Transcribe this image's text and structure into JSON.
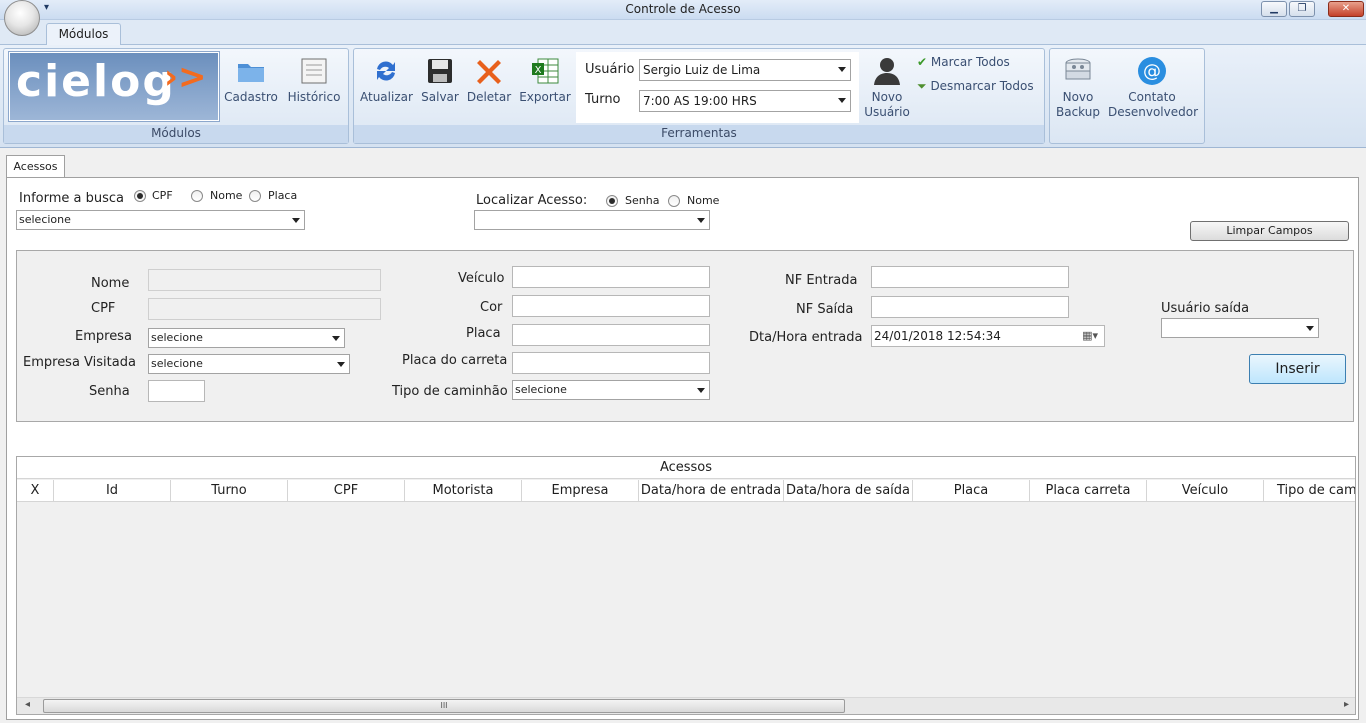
{
  "window": {
    "title": "Controle de Acesso",
    "qat_glyph": "▾",
    "minimize": "▁",
    "maximize": "❐",
    "close": "✕"
  },
  "ribbon": {
    "tab": "Módulos",
    "groups": {
      "modulos": {
        "caption": "Módulos",
        "logo_text": "cielog",
        "logo_arrow": "›>",
        "buttons": [
          {
            "label": "Cadastro",
            "icon": "folder-icon"
          },
          {
            "label": "Histórico",
            "icon": "document-icon"
          }
        ]
      },
      "ferramentas": {
        "caption": "Ferramentas",
        "buttons": [
          {
            "label": "Atualizar",
            "icon": "refresh-icon"
          },
          {
            "label": "Salvar",
            "icon": "save-icon"
          },
          {
            "label": "Deletar",
            "icon": "delete-icon"
          },
          {
            "label": "Exportar",
            "icon": "excel-icon"
          }
        ],
        "usuario_label": "Usuário",
        "usuario_value": "Sergio Luiz  de Lima",
        "turno_label": "Turno",
        "turno_value": "7:00 AS 19:00 HRS",
        "novo_usuario_1": "Novo",
        "novo_usuario_2": "Usuário",
        "marcar_todos": "Marcar Todos",
        "desmarcar_todos": "Desmarcar Todos"
      },
      "extra": {
        "novo_backup_1": "Novo",
        "novo_backup_2": "Backup",
        "contato_1": "Contato",
        "contato_2": "Desenvolvedor"
      }
    }
  },
  "content_tab": "Acessos",
  "search": {
    "label": "Informe a busca",
    "options": [
      "CPF",
      "Nome",
      "Placa"
    ],
    "selected": "CPF",
    "combo_value": "selecione"
  },
  "localizar": {
    "label": "Localizar Acesso:",
    "options": [
      "Senha",
      "Nome"
    ],
    "selected": "Senha",
    "combo_value": ""
  },
  "limpar_campos": "Limpar Campos",
  "form": {
    "nome": "Nome",
    "cpf": "CPF",
    "empresa": "Empresa",
    "empresa_value": "selecione",
    "empresa_visitada": "Empresa Visitada",
    "empresa_visitada_value": "selecione",
    "senha": "Senha",
    "veiculo": "Veículo",
    "cor": "Cor",
    "placa": "Placa",
    "placa_carreta": "Placa do carreta",
    "tipo_caminhao": "Tipo de caminhão",
    "tipo_caminhao_value": "selecione",
    "nf_entrada": "NF Entrada",
    "nf_saida": "NF Saída",
    "dta_entrada": "Dta/Hora entrada",
    "dta_entrada_value": "24/01/2018 12:54:34",
    "usuario_saida": "Usuário saída",
    "inserir": "Inserir"
  },
  "grid": {
    "caption": "Acessos",
    "columns": [
      "X",
      "Id",
      "Turno",
      "CPF",
      "Motorista",
      "Empresa",
      "Data/hora de entrada",
      "Data/hora de saída",
      "Placa",
      "Placa carreta",
      "Veículo",
      "Tipo de caminh"
    ],
    "scroll_left": "◂",
    "scroll_right": "▸",
    "thumb_grip": "III"
  }
}
